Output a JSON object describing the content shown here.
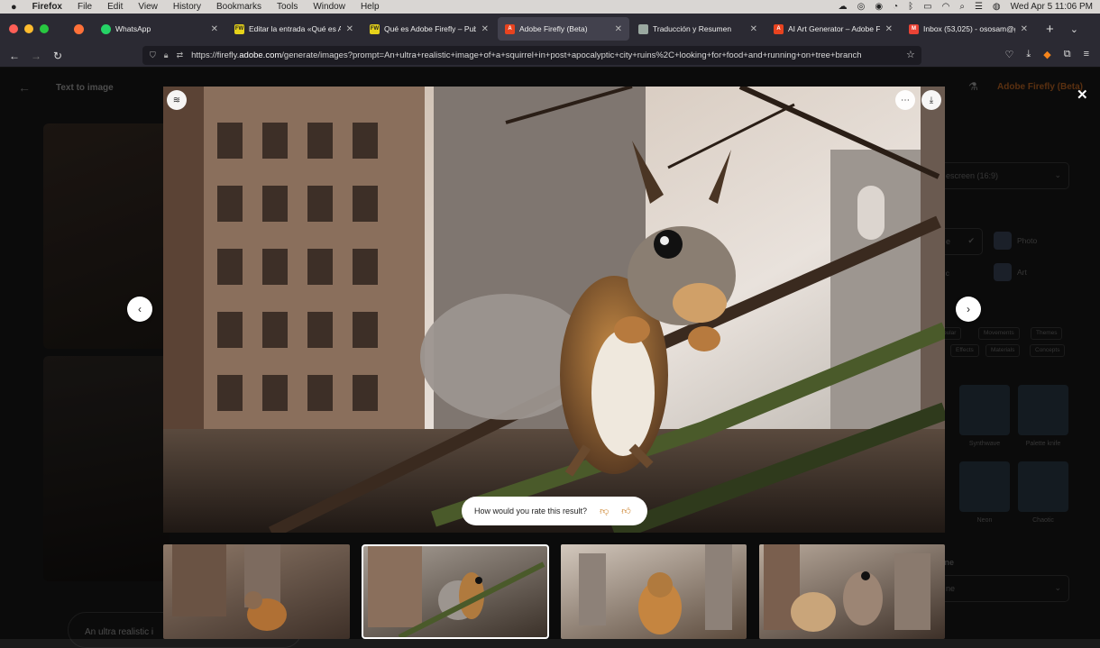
{
  "system_menu": {
    "apple": "",
    "app": "Firefox",
    "items": [
      "File",
      "Edit",
      "View",
      "History",
      "Bookmarks",
      "Tools",
      "Window",
      "Help"
    ],
    "datetime": "Wed Apr 5  11:06 PM"
  },
  "tabs": [
    {
      "title": "WhatsApp",
      "icon": "whatsapp-icon",
      "color": "#25d366"
    },
    {
      "title": "Editar la entrada «Qué es Adob",
      "icon": "fw-icon",
      "color": "#e6d21a"
    },
    {
      "title": "Qué es Adobe Firefly – Publicid",
      "icon": "fw-icon",
      "color": "#e6d21a"
    },
    {
      "title": "Adobe Firefly (Beta)",
      "icon": "adobe-icon",
      "color": "#e8431f",
      "active": true
    },
    {
      "title": "Traducción y Resumen",
      "icon": "chatgpt-icon",
      "color": "#9aa8a0"
    },
    {
      "title": "AI Art Generator – Adobe Firef",
      "icon": "adobe-icon",
      "color": "#e8431f"
    },
    {
      "title": "Inbox (53,025) - ososam@gma",
      "icon": "gmail-icon",
      "color": "#ea4335"
    }
  ],
  "url": {
    "prefix": "https://firefly.",
    "domain": "adobe.com",
    "rest": "/generate/images?prompt=An+ultra+realistic+image+of+a+squirrel+in+post+apocalyptic+city+ruins%2C+looking+for+food+and+running+on+tree+branch"
  },
  "page": {
    "title": "Text to image",
    "brand": "Adobe Firefly (Beta)",
    "prompt_preview": "An ultra realistic i"
  },
  "side_panel": {
    "aspect_label": "o",
    "aspect_value": "escreen (16:9)",
    "content_type_label": "e",
    "content_types": [
      "Photo",
      "Art"
    ],
    "left_option_1": "e",
    "left_option_2": "hic",
    "chips_row1": [
      "pular",
      "Movements",
      "Themes"
    ],
    "chips_row2": [
      "Effects",
      "Materials",
      "Concepts"
    ],
    "styles": [
      "Synthwave",
      "Palette knife",
      "Neon",
      "Chaotic"
    ],
    "tone_label": "one",
    "tone_value": "ne"
  },
  "modal": {
    "rating_question": "How would you rate this result?",
    "thumbnails": 4,
    "selected_thumbnail": 2
  }
}
